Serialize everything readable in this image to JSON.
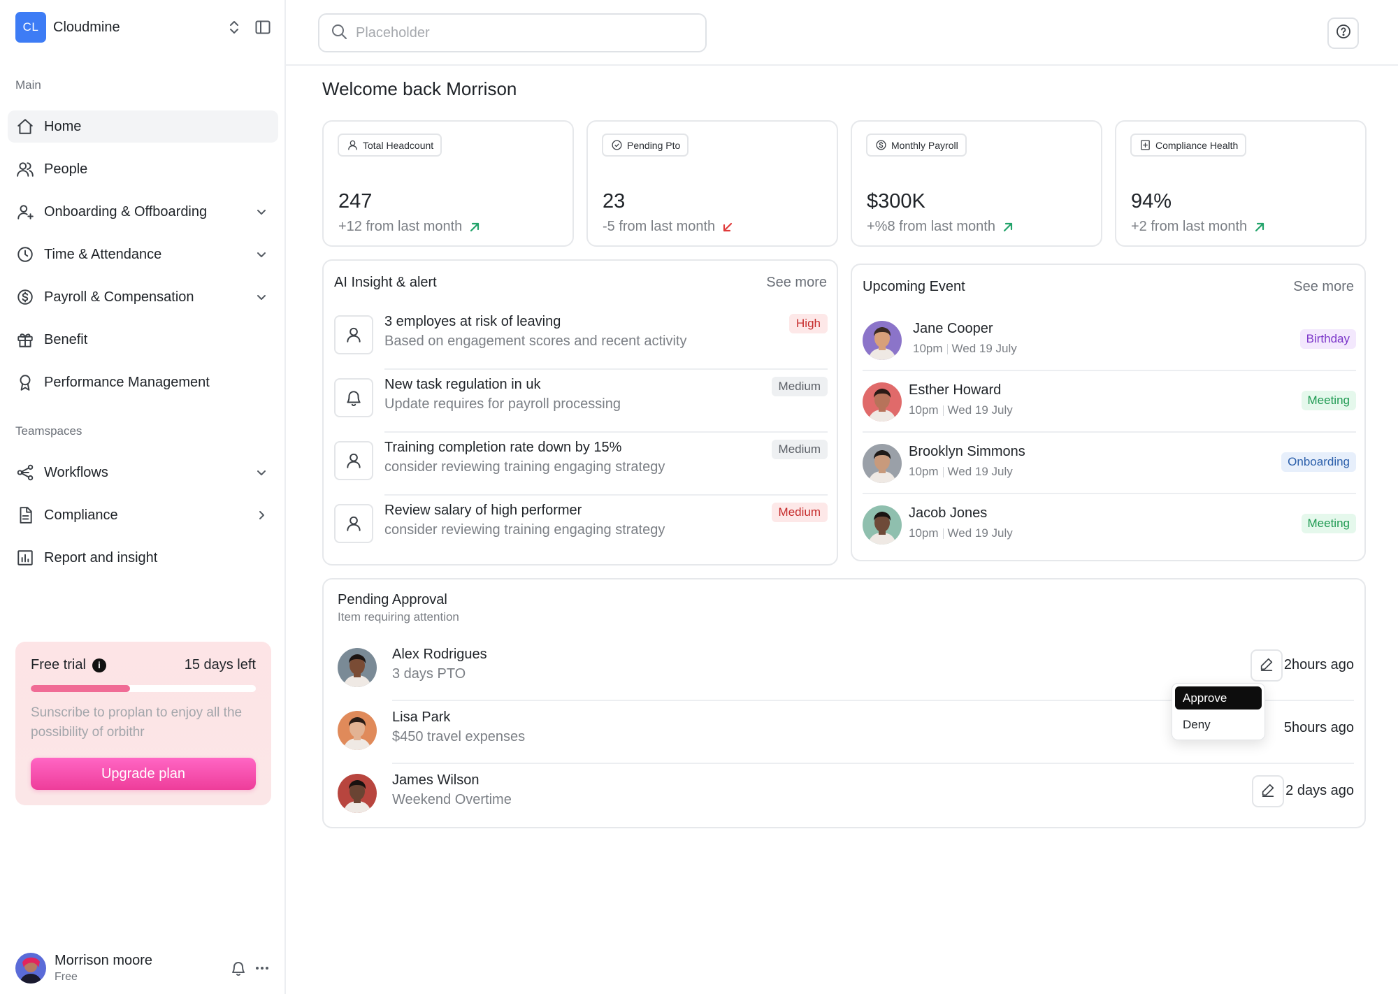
{
  "brand": {
    "logo_text": "CL",
    "name": "Cloudmine"
  },
  "sidebar": {
    "main_label": "Main",
    "main_items": [
      {
        "label": "Home",
        "icon": "home-icon",
        "active": true,
        "chevron": "none"
      },
      {
        "label": "People",
        "icon": "people-icon",
        "chevron": "none"
      },
      {
        "label": "Onboarding & Offboarding",
        "icon": "user-plus-icon",
        "chevron": "down"
      },
      {
        "label": "Time & Attendance",
        "icon": "clock-icon",
        "chevron": "down"
      },
      {
        "label": "Payroll & Compensation",
        "icon": "dollar-circle-icon",
        "chevron": "down"
      },
      {
        "label": "Benefit",
        "icon": "gift-icon",
        "chevron": "none"
      },
      {
        "label": "Performance Management",
        "icon": "award-icon",
        "chevron": "none"
      }
    ],
    "teamspaces_label": "Teamspaces",
    "team_items": [
      {
        "label": "Workflows",
        "icon": "workflow-icon",
        "chevron": "down"
      },
      {
        "label": "Compliance",
        "icon": "document-icon",
        "chevron": "right"
      },
      {
        "label": "Report and insight",
        "icon": "chart-icon",
        "chevron": "none"
      }
    ]
  },
  "trial": {
    "title": "Free trial",
    "info_icon": "info-icon",
    "days_left": "15 days left",
    "progress": 0.44,
    "description": "Sunscribe to proplan to enjoy all the possibility of orbithr",
    "button": "Upgrade plan"
  },
  "user": {
    "name": "Morrison moore",
    "plan": "Free"
  },
  "search": {
    "placeholder": "Placeholder"
  },
  "welcome": "Welcome back Morrison",
  "stats": [
    {
      "label": "Total Headcount",
      "icon": "user-icon",
      "value": "247",
      "delta": "+12 from last month",
      "trend": "up"
    },
    {
      "label": "Pending Pto",
      "icon": "clock-check-icon",
      "value": "23",
      "delta": "-5 from last month",
      "trend": "down"
    },
    {
      "label": "Monthly Payroll",
      "icon": "dollar-circle-icon",
      "value": "$300K",
      "delta": "+%8 from last month",
      "trend": "up"
    },
    {
      "label": "Compliance Health",
      "icon": "file-plus-icon",
      "value": "94%",
      "delta": "+2 from last month",
      "trend": "up"
    }
  ],
  "colors": {
    "up": "#22a36a",
    "down": "#e03b3b",
    "accent": "#3d7cf5",
    "pink": "#ee3d9a"
  },
  "insights": {
    "title": "AI Insight & alert",
    "see_more": "See more",
    "items": [
      {
        "title": "3 employes at risk of leaving",
        "subtitle": "Based on engagement scores and recent activity",
        "badge": "High",
        "badge_style": "red",
        "icon": "user-icon"
      },
      {
        "title": "New task regulation in uk",
        "subtitle": "Update requires for payroll processing",
        "badge": "Medium",
        "badge_style": "gray",
        "icon": "bell-icon"
      },
      {
        "title": "Training completion rate down by 15%",
        "subtitle": "consider reviewing training engaging strategy",
        "badge": "Medium",
        "badge_style": "gray",
        "icon": "user-icon"
      },
      {
        "title": "Review salary of high performer",
        "subtitle": "consider reviewing training engaging strategy",
        "badge": "Medium",
        "badge_style": "red",
        "icon": "user-icon"
      }
    ]
  },
  "events": {
    "title": "Upcoming Event",
    "see_more": "See more",
    "items": [
      {
        "name": "Jane Cooper",
        "time": "10pm",
        "date": "Wed 19 July",
        "tag": "Birthday",
        "tag_style": "purple",
        "avatar_bg": "#8b74c9",
        "skin": "#d8a07a",
        "hair": "#3a2a22"
      },
      {
        "name": "Esther Howard",
        "time": "10pm",
        "date": "Wed 19 July",
        "tag": "Meeting",
        "tag_style": "green",
        "avatar_bg": "#e06a6a",
        "skin": "#b7735a",
        "hair": "#2a1a15"
      },
      {
        "name": "Brooklyn Simmons",
        "time": "10pm",
        "date": "Wed 19 July",
        "tag": "Onboarding",
        "tag_style": "blue",
        "avatar_bg": "#9aa0a8",
        "skin": "#c89a7c",
        "hair": "#1e1a18"
      },
      {
        "name": "Jacob Jones",
        "time": "10pm",
        "date": "Wed 19 July",
        "tag": "Meeting",
        "tag_style": "green",
        "avatar_bg": "#8fbfae",
        "skin": "#6e4a38",
        "hair": "#1a1412"
      }
    ]
  },
  "approvals": {
    "title": "Pending Approval",
    "subtitle": "Item requiring attention",
    "items": [
      {
        "name": "Alex Rodrigues",
        "detail": "3 days PTO",
        "time": "2hours ago",
        "avatar_bg": "#7a8a96",
        "skin": "#7a4c35",
        "hair": "#1c1412"
      },
      {
        "name": "Lisa Park",
        "detail": "$450 travel expenses",
        "time": "5hours ago",
        "avatar_bg": "#e08a5a",
        "skin": "#e2b394",
        "hair": "#2a1c16"
      },
      {
        "name": "James Wilson",
        "detail": "Weekend Overtime",
        "time": "2 days ago",
        "avatar_bg": "#b8453e",
        "skin": "#6a4433",
        "hair": "#181210"
      }
    ],
    "menu": {
      "approve": "Approve",
      "deny": "Deny"
    }
  }
}
